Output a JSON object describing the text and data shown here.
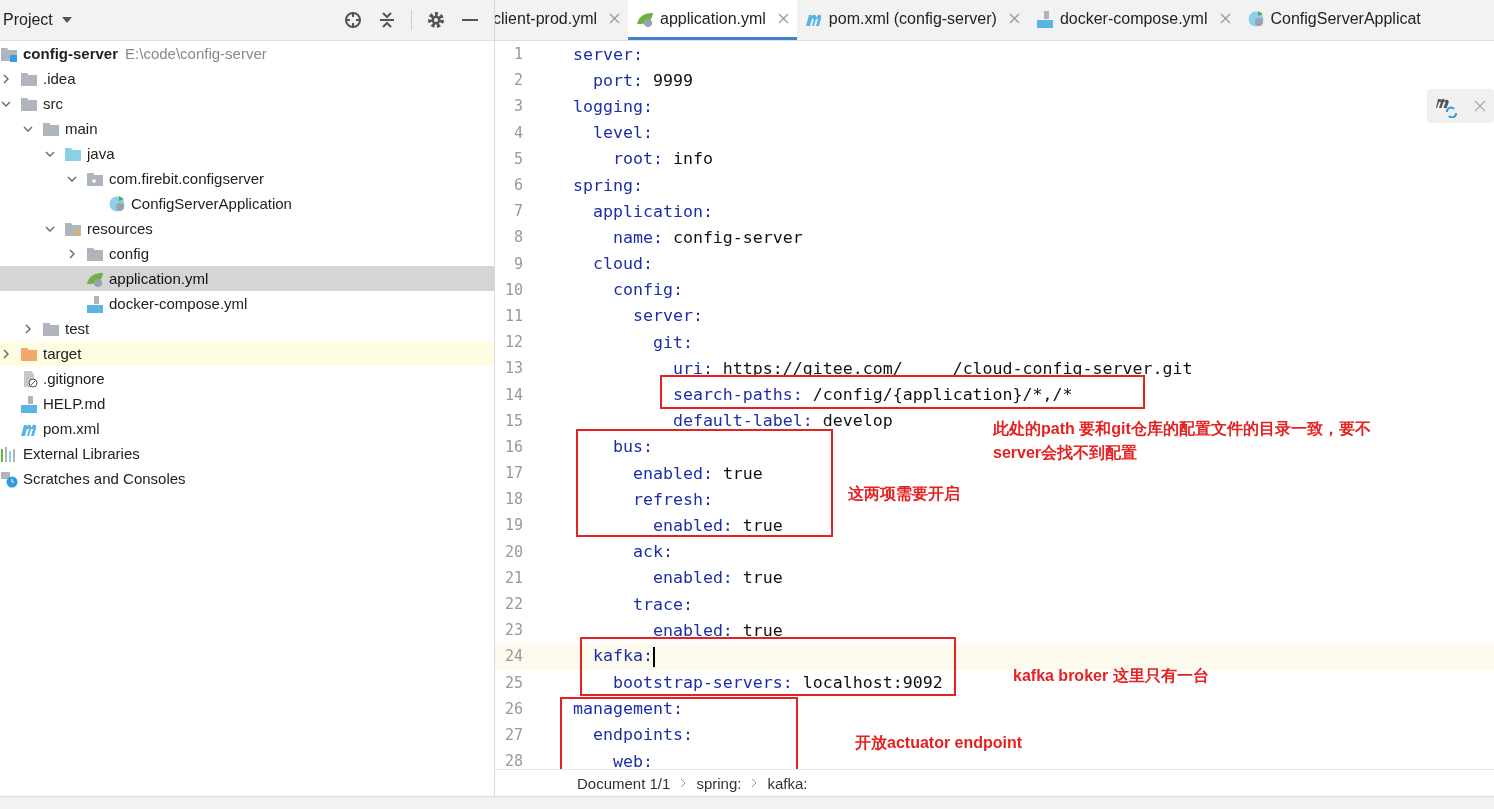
{
  "project_panel": {
    "title": "Project",
    "tree": [
      {
        "label": "config-server",
        "path": "E:\\code\\config-server",
        "kind": "module",
        "selected": false,
        "children": [
          {
            "label": ".idea",
            "kind": "folder",
            "expanded": false,
            "selected": false
          },
          {
            "label": "src",
            "kind": "folder",
            "expanded": true,
            "selected": false,
            "children": [
              {
                "label": "main",
                "kind": "folder",
                "expanded": true,
                "selected": false,
                "children": [
                  {
                    "label": "java",
                    "kind": "source",
                    "expanded": true,
                    "selected": false,
                    "children": [
                      {
                        "label": "com.firebit.configserver",
                        "kind": "package",
                        "expanded": true,
                        "selected": false,
                        "children": [
                          {
                            "label": "ConfigServerApplication",
                            "kind": "spring-class",
                            "selected": false
                          }
                        ]
                      }
                    ]
                  },
                  {
                    "label": "resources",
                    "kind": "resources",
                    "expanded": true,
                    "selected": false,
                    "children": [
                      {
                        "label": "config",
                        "kind": "folder",
                        "expanded": false,
                        "selected": false
                      },
                      {
                        "label": "application.yml",
                        "kind": "yaml",
                        "selected": true
                      },
                      {
                        "label": "docker-compose.yml",
                        "kind": "docker",
                        "selected": false
                      }
                    ]
                  }
                ]
              },
              {
                "label": "test",
                "kind": "folder",
                "expanded": false,
                "selected": false
              }
            ]
          },
          {
            "label": "target",
            "kind": "excluded",
            "expanded": false,
            "selected": false
          },
          {
            "label": ".gitignore",
            "kind": "ignore",
            "selected": false
          },
          {
            "label": "HELP.md",
            "kind": "md",
            "selected": false
          },
          {
            "label": "pom.xml",
            "kind": "maven",
            "selected": false
          }
        ]
      },
      {
        "label": "External Libraries",
        "kind": "libraries",
        "selected": false
      },
      {
        "label": "Scratches and Consoles",
        "kind": "scratches",
        "selected": false
      }
    ]
  },
  "editor": {
    "tabs": [
      {
        "label": "client-prod.yml",
        "selected": false
      },
      {
        "label": "application.yml",
        "kind": "yaml",
        "selected": true
      },
      {
        "label": "pom.xml (config-server)",
        "kind": "maven",
        "selected": false
      },
      {
        "label": "docker-compose.yml",
        "kind": "docker",
        "selected": false
      },
      {
        "label": "ConfigServerApplicat",
        "kind": "spring-class",
        "selected": false
      }
    ],
    "lines": [
      {
        "number": "1",
        "key": "server:",
        "current": false
      },
      {
        "number": "2",
        "key": "  port:",
        "value": "9999",
        "current": false
      },
      {
        "number": "3",
        "key": "logging:",
        "current": false
      },
      {
        "number": "4",
        "key": "  level:",
        "current": false
      },
      {
        "number": "5",
        "key": "    root:",
        "value": "info",
        "current": false
      },
      {
        "number": "6",
        "key": "spring:",
        "current": false
      },
      {
        "number": "7",
        "key": "  application:",
        "current": false
      },
      {
        "number": "8",
        "key": "    name:",
        "value": "config-server",
        "current": false
      },
      {
        "number": "9",
        "key": "  cloud:",
        "current": false
      },
      {
        "number": "10",
        "key": "    config:",
        "current": false
      },
      {
        "number": "11",
        "key": "      server:",
        "current": false
      },
      {
        "number": "12",
        "key": "        git:",
        "current": false
      },
      {
        "number": "13",
        "key": "          uri:",
        "value": "https://gitee.com/     /cloud-config-server.git",
        "current": false
      },
      {
        "number": "14",
        "key": "          search-paths:",
        "value": "/config/{application}/*,/*",
        "current": false
      },
      {
        "number": "15",
        "key": "          default-label:",
        "value": "develop",
        "current": false
      },
      {
        "number": "16",
        "key": "    bus:",
        "current": false
      },
      {
        "number": "17",
        "key": "      enabled:",
        "value": "true",
        "current": false
      },
      {
        "number": "18",
        "key": "      refresh:",
        "current": false
      },
      {
        "number": "19",
        "key": "        enabled:",
        "value": "true",
        "current": false
      },
      {
        "number": "20",
        "key": "      ack:",
        "current": false
      },
      {
        "number": "21",
        "key": "        enabled:",
        "value": "true",
        "current": false
      },
      {
        "number": "22",
        "key": "      trace:",
        "current": false
      },
      {
        "number": "23",
        "key": "        enabled:",
        "value": "true",
        "current": false
      },
      {
        "number": "24",
        "key": "  kafka:",
        "current": true
      },
      {
        "number": "25",
        "key": "    bootstrap-servers:",
        "value": "localhost:9092",
        "current": false
      },
      {
        "number": "26",
        "key": "management:",
        "current": false
      },
      {
        "number": "27",
        "key": "  endpoints:",
        "current": false
      },
      {
        "number": "28",
        "key": "    web:",
        "current": false
      }
    ],
    "annotations": [
      "此处的path 要和git仓库的配置文件的目录一致，要不\nserver会找不到配置",
      "这两项需要开启",
      "kafka broker 这里只有一台",
      "开放actuator endpoint"
    ],
    "breadcrumbs": [
      "Document 1/1",
      "spring:",
      "kafka:"
    ]
  }
}
